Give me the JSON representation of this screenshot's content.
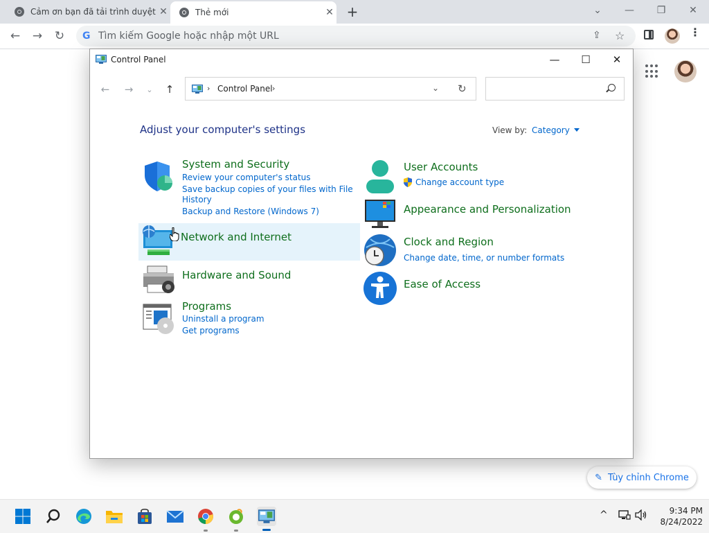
{
  "browser": {
    "tabs": [
      {
        "title": "Cảm ơn bạn đã tải trình duyệt Ch",
        "active": false
      },
      {
        "title": "Thẻ mới",
        "active": true
      }
    ],
    "new_tab_glyph": "+",
    "window_controls": {
      "minimize": "—",
      "restore": "❐",
      "close": "✕",
      "search_tabs": "⌄"
    },
    "toolbar": {
      "back": "←",
      "forward": "→",
      "reload": "↻",
      "omnibox_placeholder": "Tìm kiếm Google hoặc nhập một URL",
      "google_glyph": "G"
    }
  },
  "ntp": {
    "customize_label": "Tùy chỉnh Chrome",
    "customize_icon": "pencil-icon"
  },
  "control_panel": {
    "window_title": "Control Panel",
    "window_controls": {
      "minimize": "—",
      "maximize": "☐",
      "close": "✕"
    },
    "nav": {
      "back": "←",
      "forward": "→",
      "recent": "⌄",
      "up": "↑"
    },
    "address": {
      "separator": "›",
      "crumb": "Control Panel",
      "dropdown": "⌄",
      "refresh": "↻"
    },
    "heading": "Adjust your computer's settings",
    "view_by_label": "View by:",
    "view_by_value": "Category",
    "categories": [
      {
        "title": "System and Security",
        "icon": "shield-icon",
        "links": [
          "Review your computer's status",
          "Save backup copies of your files with File",
          "History",
          "Backup and Restore (Windows 7)"
        ]
      },
      {
        "title": "Network and Internet",
        "icon": "network-icon",
        "links": []
      },
      {
        "title": "Hardware and Sound",
        "icon": "printer-icon",
        "links": []
      },
      {
        "title": "Programs",
        "icon": "programs-icon",
        "links": [
          "Uninstall a program",
          "Get programs"
        ]
      },
      {
        "title": "User Accounts",
        "icon": "user-icon",
        "links": [
          "Change account type"
        ]
      },
      {
        "title": "Appearance and Personalization",
        "icon": "monitor-icon",
        "links": []
      },
      {
        "title": "Clock and Region",
        "icon": "clock-globe-icon",
        "links": [
          "Change date, time, or number formats"
        ]
      },
      {
        "title": "Ease of Access",
        "icon": "accessibility-icon",
        "links": []
      }
    ]
  },
  "taskbar": {
    "items": [
      "windows-start-icon",
      "search-icon",
      "edge-icon",
      "file-explorer-icon",
      "store-icon",
      "mail-icon",
      "chrome-icon",
      "coccoc-icon",
      "control-panel-icon"
    ],
    "tray": {
      "chevron": "^",
      "network_icon": "network-tray-icon",
      "volume_icon": "volume-icon"
    },
    "time": "9:34 PM",
    "date": "8/24/2022"
  },
  "colors": {
    "tabstrip_bg": "#dee1e6",
    "link_blue": "#0066cc",
    "category_green": "#0e6e1c",
    "heading_blue": "#1e3287",
    "hover_bg": "#e5f3fb",
    "chrome_accent": "#1a73e8"
  }
}
